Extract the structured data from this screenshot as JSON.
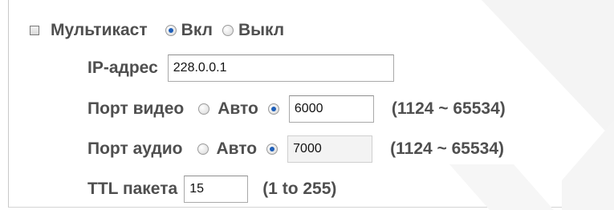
{
  "multicast": {
    "label": "Мультикаст",
    "on_label": "Вкл",
    "off_label": "Выкл",
    "on_selected": true
  },
  "ip_address": {
    "label": "IP-адрес",
    "value": "228.0.0.1"
  },
  "video_port": {
    "label": "Порт видео",
    "auto_label": "Авто",
    "value": "6000",
    "range": "(1124 ~ 65534)",
    "auto_selected": false
  },
  "audio_port": {
    "label": "Порт аудио",
    "auto_label": "Авто",
    "value": "7000",
    "range": "(1124 ~ 65534)",
    "auto_selected": false
  },
  "ttl": {
    "label": "TTL пакета",
    "value": "15",
    "range": "(1 to 255)"
  },
  "colors": {
    "text": "#4f4f4f",
    "radio_dot": "#1f5fb8",
    "input_border": "#a9a9a9",
    "panel_border": "#c9c9c9",
    "watermark": "#f4f4f4"
  },
  "icons": {
    "section_checkbox": "square-checkbox-icon",
    "radio_on": "radio-selected-icon",
    "radio_off": "radio-unselected-icon",
    "watermark": "brand-watermark-icon"
  }
}
